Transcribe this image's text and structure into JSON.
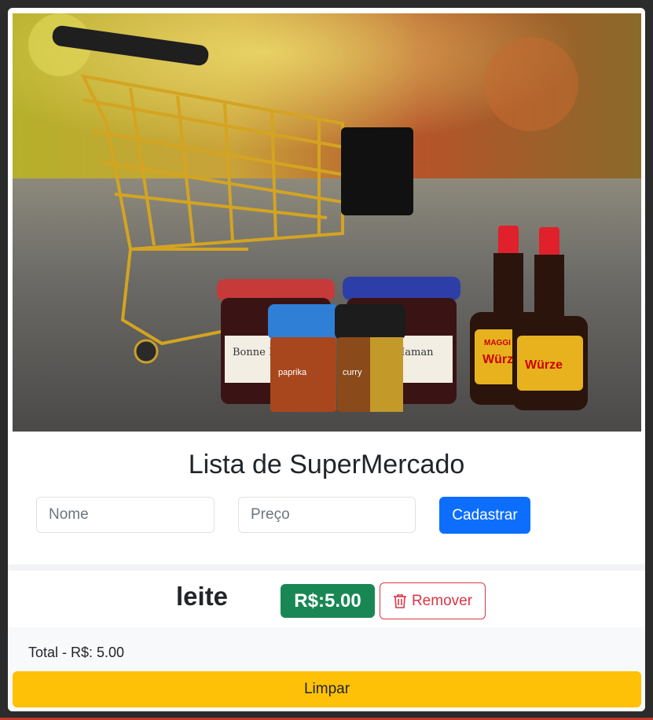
{
  "header": {
    "title": "Lista de SuperMercado"
  },
  "form": {
    "name_placeholder": "Nome",
    "price_placeholder": "Preço",
    "submit_label": "Cadastrar"
  },
  "items": [
    {
      "name": "leite",
      "price_label": "R$:5.00",
      "remove_label": "Remover"
    }
  ],
  "summary": {
    "total_label": "Total - R$: 5.00",
    "clear_label": "Limpar"
  },
  "hero_image": {
    "jar_labels": [
      "Bonne Maman",
      "Bonne Maman"
    ],
    "spice_labels": [
      "paprika",
      "curry"
    ],
    "bottle_brand": "MAGGI",
    "bottle_labels": [
      "Würze",
      "Würze"
    ]
  },
  "colors": {
    "primary": "#0d6efd",
    "success": "#198754",
    "danger": "#dc3545",
    "warning": "#ffc107"
  },
  "icons": {
    "remove": "trash-icon"
  }
}
